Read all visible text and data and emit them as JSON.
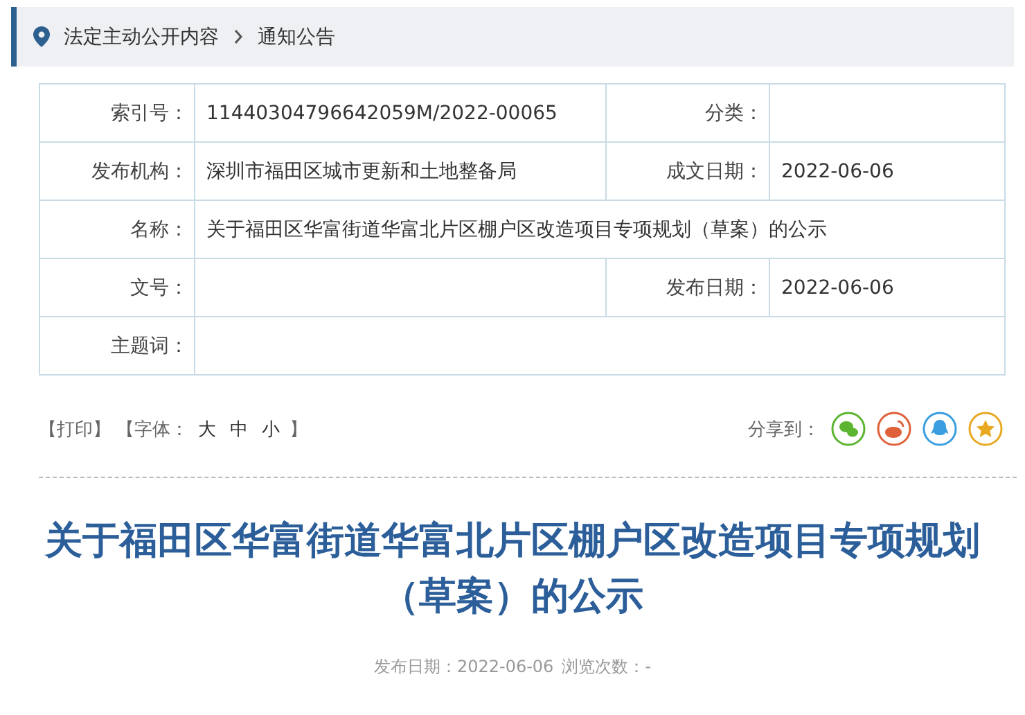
{
  "breadcrumb": [
    "法定主动公开内容",
    "通知公告"
  ],
  "info_table": [
    {
      "cells": [
        {
          "label": "索引号：",
          "value": "11440304796642059M/2022-00065"
        },
        {
          "label": "分类："
        }
      ]
    },
    {
      "cells": [
        {
          "label": "发布机构：",
          "value": "深圳市福田区城市更新和土地整备局"
        },
        {
          "label": "成文日期：",
          "value": "2022-06-06"
        }
      ]
    },
    {
      "cells": [
        {
          "label": "名称：",
          "value": "关于福田区华富街道华富北片区棚户区改造项目专项规划（草案）的公示"
        }
      ]
    },
    {
      "cells": [
        {
          "label": "文号："
        },
        {
          "label": "发布日期：",
          "value": "2022-06-06"
        }
      ]
    },
    {
      "cells": [
        {
          "label": "主题词："
        }
      ]
    }
  ],
  "tools": {
    "print": "【打印】",
    "font_open": "【字体：",
    "sizes": [
      "大",
      "中",
      "小"
    ],
    "font_close": "】"
  },
  "share": {
    "label": "分享到：",
    "icons": [
      {
        "kind": "wechat",
        "color": "#5cb531"
      },
      {
        "kind": "weibo",
        "color": "#e0603a"
      },
      {
        "kind": "qq",
        "color": "#3a9ee0"
      },
      {
        "kind": "star",
        "color": "#e8a921"
      }
    ]
  },
  "article": {
    "title": "关于福田区华富街道华富北片区棚户区改造项目专项规划（草案）的公示",
    "meta": [
      "发布日期：2022-06-06",
      "浏览次数：-"
    ]
  }
}
